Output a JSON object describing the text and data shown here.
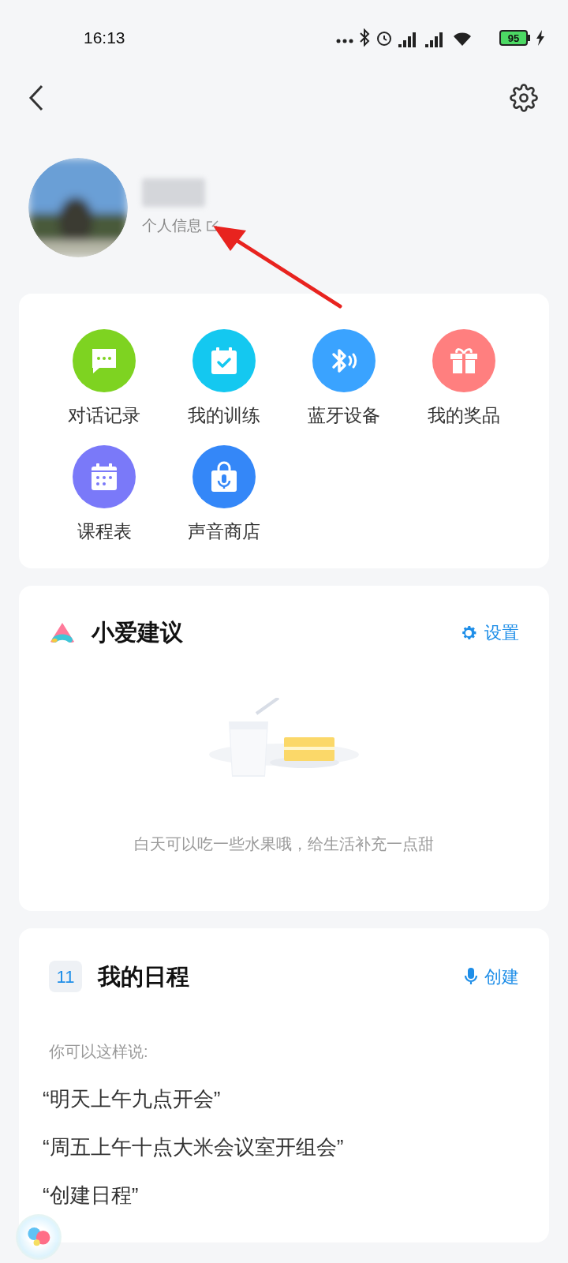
{
  "status_bar": {
    "time": "16:13",
    "battery": "95"
  },
  "profile": {
    "info_label": "个人信息"
  },
  "shortcuts": [
    {
      "label": "对话记录",
      "kind": "chat",
      "color": "#7ed321"
    },
    {
      "label": "我的训练",
      "kind": "training",
      "color": "#14c8f0"
    },
    {
      "label": "蓝牙设备",
      "kind": "bluetooth",
      "color": "#3aa3ff"
    },
    {
      "label": "我的奖品",
      "kind": "gift",
      "color": "#ff7f7f"
    },
    {
      "label": "课程表",
      "kind": "schedule",
      "color": "#7a79f9"
    },
    {
      "label": "声音商店",
      "kind": "store",
      "color": "#3487f8"
    }
  ],
  "suggestions": {
    "title": "小爱建议",
    "settings_label": "设置",
    "message": "白天可以吃一些水果哦，给生活补充一点甜"
  },
  "schedule": {
    "date_badge": "11",
    "title": "我的日程",
    "create_label": "创建",
    "hint": "你可以这样说:",
    "examples": [
      "“明天上午九点开会”",
      "“周五上午十点大米会议室开组会”",
      "“创建日程”"
    ]
  }
}
